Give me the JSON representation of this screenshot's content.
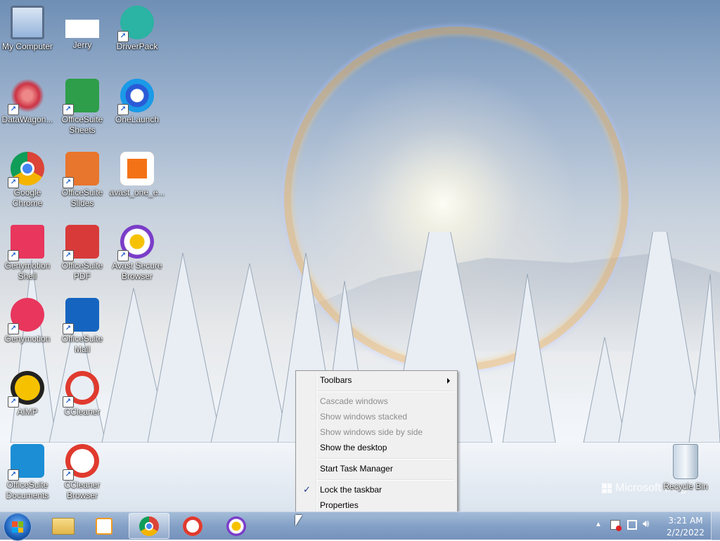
{
  "desktop": {
    "icons": [
      {
        "label": "My Computer",
        "icon": "computer-icon"
      },
      {
        "label": "Jerry",
        "icon": "jerry-icon"
      },
      {
        "label": "DriverPack",
        "icon": "driverpack-icon"
      },
      {
        "label": "DataWagon...",
        "icon": "datawagon-icon"
      },
      {
        "label": "OfficeSuite\nSheets",
        "icon": "officesuite-sheets-icon"
      },
      {
        "label": "OneLaunch",
        "icon": "onelaunch-icon"
      },
      {
        "label": "Google\nChrome",
        "icon": "chrome-icon"
      },
      {
        "label": "OfficeSuite\nSlides",
        "icon": "officesuite-slides-icon"
      },
      {
        "label": "avast_one_e...",
        "icon": "avast-installer-icon"
      },
      {
        "label": "Genymotion\nShell",
        "icon": "genymotion-shell-icon"
      },
      {
        "label": "OfficeSuite\nPDF",
        "icon": "officesuite-pdf-icon"
      },
      {
        "label": "Avast Secure\nBrowser",
        "icon": "avast-browser-icon"
      },
      {
        "label": "Genymotion",
        "icon": "genymotion-icon"
      },
      {
        "label": "OfficeSuite\nMail",
        "icon": "officesuite-mail-icon"
      },
      {
        "label": "AIMP",
        "icon": "aimp-icon"
      },
      {
        "label": "CCleaner",
        "icon": "ccleaner-icon"
      },
      {
        "label": "OfficeSuite\nDocuments",
        "icon": "officesuite-documents-icon"
      },
      {
        "label": "CCleaner\nBrowser",
        "icon": "ccleaner-browser-icon"
      },
      {
        "label": "Recycle Bin",
        "icon": "recycle-bin-icon"
      }
    ],
    "watermark": "Microsoft Bing"
  },
  "context_menu": {
    "items": [
      {
        "label": "Toolbars",
        "enabled": true,
        "submenu": true
      },
      {
        "label": "Cascade windows",
        "enabled": false
      },
      {
        "label": "Show windows stacked",
        "enabled": false
      },
      {
        "label": "Show windows side by side",
        "enabled": false
      },
      {
        "label": "Show the desktop",
        "enabled": true
      },
      {
        "label": "Start Task Manager",
        "enabled": true
      },
      {
        "label": "Lock the taskbar",
        "enabled": true,
        "checked": true
      },
      {
        "label": "Properties",
        "enabled": true
      }
    ]
  },
  "taskbar": {
    "start_icon": "windows-start-icon",
    "pinned": [
      {
        "name": "file-explorer",
        "icon": "folder-icon",
        "active": false
      },
      {
        "name": "media-player",
        "icon": "media-player-icon",
        "active": false
      },
      {
        "name": "google-chrome",
        "icon": "chrome-icon",
        "active": true
      },
      {
        "name": "ccleaner-browser",
        "icon": "ccleaner-browser-icon",
        "active": false
      },
      {
        "name": "avast-secure-browser",
        "icon": "avast-browser-icon",
        "active": false
      }
    ],
    "tray": {
      "icons": [
        "show-hidden-icons-chevron",
        "action-center-flag-icon",
        "network-icon",
        "volume-icon"
      ],
      "time": "3:21 AM",
      "date": "2/2/2022"
    }
  },
  "colors": {
    "menu_bg": "#f0f0f0",
    "disabled_text": "#8d8d8d",
    "accent": "#1c5fb8"
  }
}
